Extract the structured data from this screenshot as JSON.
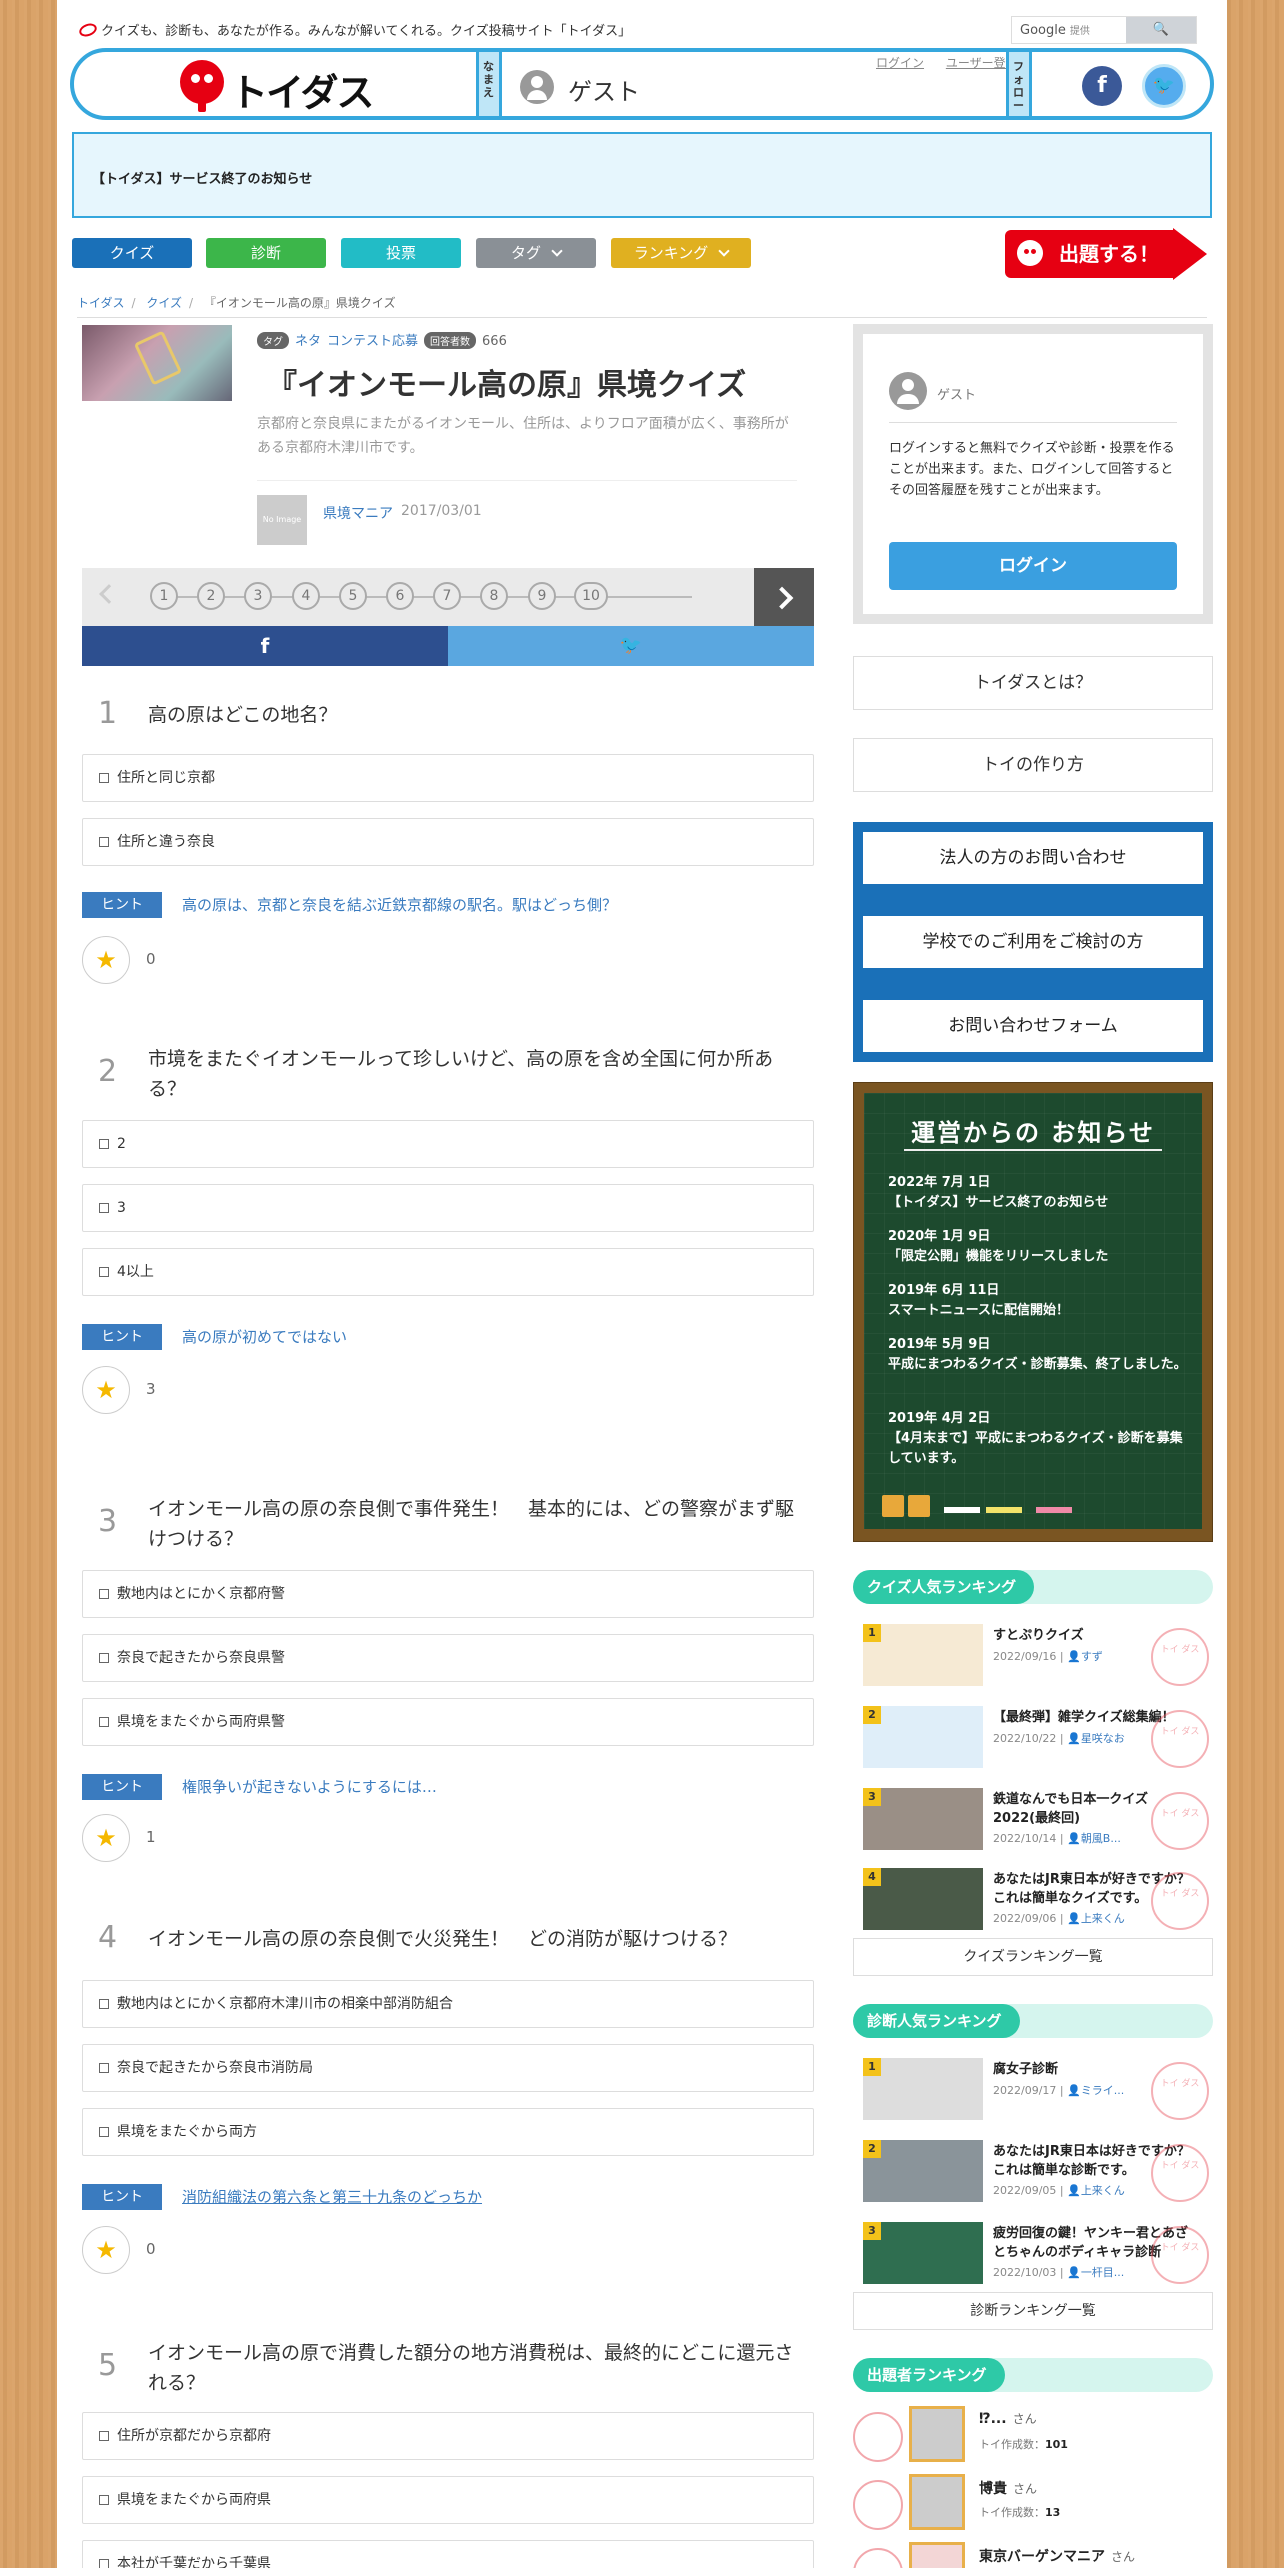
{
  "topbar": {
    "tagline": "クイズも、診断も、あなたが作る。みんなが解いてくれる。クイズ投稿サイト「トイダス」",
    "google": "Google",
    "google_sub": "提供"
  },
  "header": {
    "logo_text": "トイダス",
    "name_label": "なまえ",
    "guest_name": "ゲスト",
    "login": "ログイン",
    "register": "ユーザー登録",
    "follow_label": "フォロー"
  },
  "notice": "【トイダス】サービス終了のお知らせ",
  "nav": [
    {
      "label": "クイズ",
      "color": "#1a70b8"
    },
    {
      "label": "診断",
      "color": "#3cb64a"
    },
    {
      "label": "投票",
      "color": "#22bcc6"
    },
    {
      "label": "タグ",
      "color": "#8a9096"
    },
    {
      "label": "ランキング",
      "color": "#e0b020"
    }
  ],
  "post_button": "出題する！",
  "breadcrumb": [
    "トイダス",
    "クイズ",
    "『イオンモール高の原』県境クイズ"
  ],
  "quiz": {
    "tag_badge": "タグ",
    "tags": [
      "ネタ",
      "コンテスト応募"
    ],
    "answer_badge": "回答者数",
    "answer_count": "666",
    "title": "『イオンモール高の原』県境クイズ",
    "description": "京都府と奈良県にまたがるイオンモール、住所は、よりフロア面積が広く、事務所がある京都府木津川市です。",
    "no_image": "No Image",
    "author": "県境マニア",
    "date": "2017/03/01"
  },
  "pager": [
    "1",
    "2",
    "3",
    "4",
    "5",
    "6",
    "7",
    "8",
    "9",
    "10"
  ],
  "share": {
    "fb": "f",
    "tw": "🐦"
  },
  "questions": [
    {
      "num": "1",
      "text": "高の原はどこの地名？",
      "options": [
        "住所と同じ京都",
        "住所と違う奈良"
      ],
      "hint_label": "ヒント",
      "hint": "高の原は、京都と奈良を結ぶ近鉄京都線の駅名。駅はどっち側？",
      "likes": "0"
    },
    {
      "num": "2",
      "text": "市境をまたぐイオンモールって珍しいけど、高の原を含め全国に何か所ある？",
      "options": [
        "2",
        "3",
        "4以上"
      ],
      "hint_label": "ヒント",
      "hint": "高の原が初めてではない",
      "likes": "3"
    },
    {
      "num": "3",
      "text": "イオンモール高の原の奈良側で事件発生！　基本的には、どの警察がまず駆けつける？",
      "options": [
        "敷地内はとにかく京都府警",
        "奈良で起きたから奈良県警",
        "県境をまたぐから両府県警"
      ],
      "hint_label": "ヒント",
      "hint": "権限争いが起きないようにするには…",
      "likes": "1"
    },
    {
      "num": "4",
      "text": "イオンモール高の原の奈良側で火災発生！　どの消防が駆けつける？",
      "options": [
        "敷地内はとにかく京都府木津川市の相楽中部消防組合",
        "奈良で起きたから奈良市消防局",
        "県境をまたぐから両方"
      ],
      "hint_label": "ヒント",
      "hint": "消防組織法の第六条と第三十九条のどっちか",
      "likes": "0"
    },
    {
      "num": "5",
      "text": "イオンモール高の原で消費した額分の地方消費税は、最終的にどこに還元される？",
      "options": [
        "住所が京都だから京都府",
        "県境をまたぐから両府県",
        "本社が千葉だから千葉県"
      ]
    }
  ],
  "sidebar": {
    "guest": "ゲスト",
    "guest_text": "ログインすると無料でクイズや診断・投票を作ることが出来ます。また、ログインして回答するとその回答履歴を残すことが出来ます。",
    "login_btn": "ログイン",
    "about": "トイダスとは？",
    "howto": "トイの作り方",
    "contact": [
      "法人の方のお問い合わせ",
      "学校でのご利用をご検討の方",
      "お問い合わせフォーム"
    ],
    "board_title": "運営からの お知らせ",
    "news": [
      {
        "date": "2022年 7月 1日",
        "text": "【トイダス】サービス終了のお知らせ"
      },
      {
        "date": "2020年 1月 9日",
        "text": "「限定公開」機能をリリースしました"
      },
      {
        "date": "2019年 6月 11日",
        "text": "スマートニュースに配信開始！"
      },
      {
        "date": "2019年 5月 9日",
        "text": "平成にまつわるクイズ・診断募集、終了しました。"
      },
      {
        "date": "2019年 4月 2日",
        "text": "【4月末まで】平成にまつわるクイズ・診断を募集しています。"
      }
    ],
    "quiz_rank_title": "クイズ人気ランキング",
    "quiz_rank": [
      {
        "num": "1",
        "title": "すとぷりクイズ",
        "date": "2022/09/16",
        "user": "すず"
      },
      {
        "num": "2",
        "title": "【最終弾】雑学クイズ総集編！",
        "date": "2022/10/22",
        "user": "星咲なお"
      },
      {
        "num": "3",
        "title": "鉄道なんでも日本一クイズ2022(最終回)",
        "date": "2022/10/14",
        "user": "朝風B..."
      },
      {
        "num": "4",
        "title": "あなたはJR東日本が好きですか？これは簡単なクイズです。",
        "date": "2022/09/06",
        "user": "上来くん"
      }
    ],
    "quiz_rank_more": "クイズランキング一覧",
    "diag_rank_title": "診断人気ランキング",
    "diag_rank": [
      {
        "num": "1",
        "title": "腐女子診断",
        "date": "2022/09/17",
        "user": "ミライ..."
      },
      {
        "num": "2",
        "title": "あなたはJR東日本は好きですか？これは簡単な診断です。",
        "date": "2022/09/05",
        "user": "上来くん"
      },
      {
        "num": "3",
        "title": "疲労回復の鍵！ヤンキー君とあざとちゃんのボディキャラ診断",
        "date": "2022/10/03",
        "user": "一杆目..."
      }
    ],
    "diag_rank_more": "診断ランキング一覧",
    "author_rank_title": "出題者ランキング",
    "author_rank": [
      {
        "name": "⁉...",
        "san": "さん",
        "count_label": "トイ作成数：",
        "count": "101"
      },
      {
        "name": "博貴",
        "san": "さん",
        "count_label": "トイ作成数：",
        "count": "13"
      },
      {
        "name": "東京バーゲンマニア",
        "san": "さん"
      }
    ],
    "stamp_text": "トイ\nダス"
  }
}
